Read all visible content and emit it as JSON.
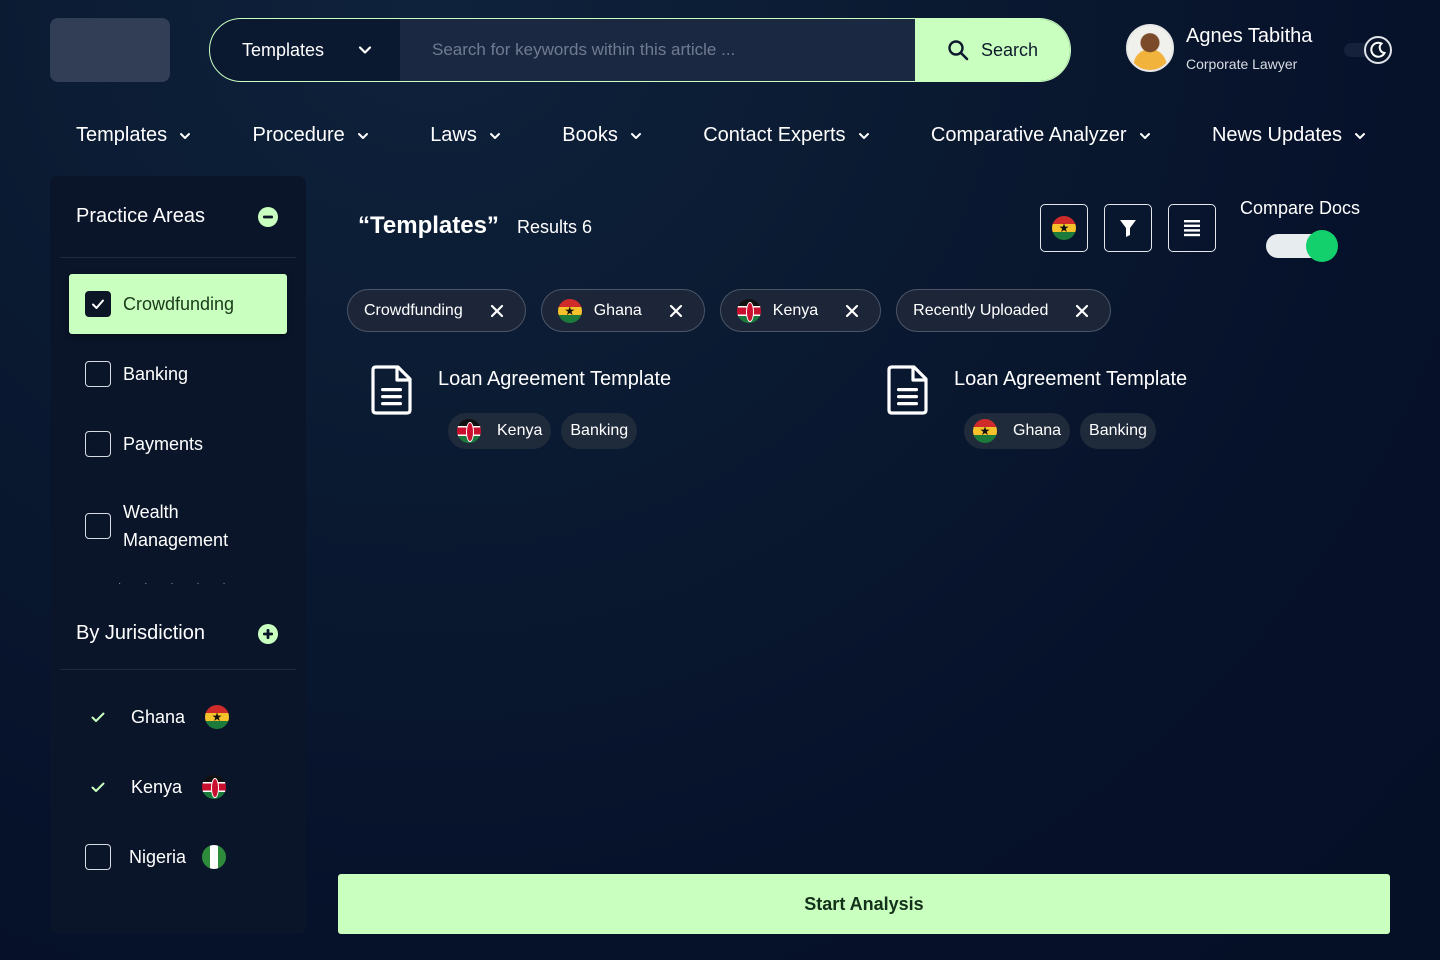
{
  "header": {
    "search_category": "Templates",
    "search_placeholder": "Search for keywords within this article ...",
    "search_value": "",
    "search_button": "Search",
    "user": {
      "name": "Agnes Tabitha",
      "role": "Corporate Lawyer"
    }
  },
  "nav": [
    "Templates",
    "Procedure",
    "Laws",
    "Books",
    "Contact Experts",
    "Comparative Analyzer",
    "News Updates"
  ],
  "sidebar": {
    "practice_title": "Practice Areas",
    "practice_items": [
      {
        "label": "Crowdfunding",
        "checked": true
      },
      {
        "label": "Banking",
        "checked": false
      },
      {
        "label": "Payments",
        "checked": false
      },
      {
        "label": "Wealth Management",
        "checked": false
      }
    ],
    "jurisdiction_title": "By Jurisdiction",
    "jurisdictions": [
      {
        "label": "Ghana",
        "checked": true,
        "flag": "ghana"
      },
      {
        "label": "Kenya",
        "checked": true,
        "flag": "kenya"
      },
      {
        "label": "Nigeria",
        "checked": false,
        "flag": "nigeria"
      }
    ]
  },
  "results": {
    "title": "“Templates”",
    "count": "Results 6",
    "compare_label": "Compare Docs",
    "compare_on": true
  },
  "filters": [
    {
      "label": "Crowdfunding",
      "flag": ""
    },
    {
      "label": "Ghana",
      "flag": "ghana"
    },
    {
      "label": "Kenya",
      "flag": "kenya"
    },
    {
      "label": "Recently Uploaded",
      "flag": ""
    }
  ],
  "documents": [
    {
      "title": "Loan Agreement Template",
      "country": "Kenya",
      "flag": "kenya",
      "area": "Banking"
    },
    {
      "title": "Loan Agreement Template",
      "country": "Ghana",
      "flag": "ghana",
      "area": "Banking"
    }
  ],
  "actions": {
    "start_analysis": "Start Analysis"
  },
  "colors": {
    "accent": "#c9ffbf",
    "toggle_on": "#13d06d",
    "background": "#06112a"
  }
}
